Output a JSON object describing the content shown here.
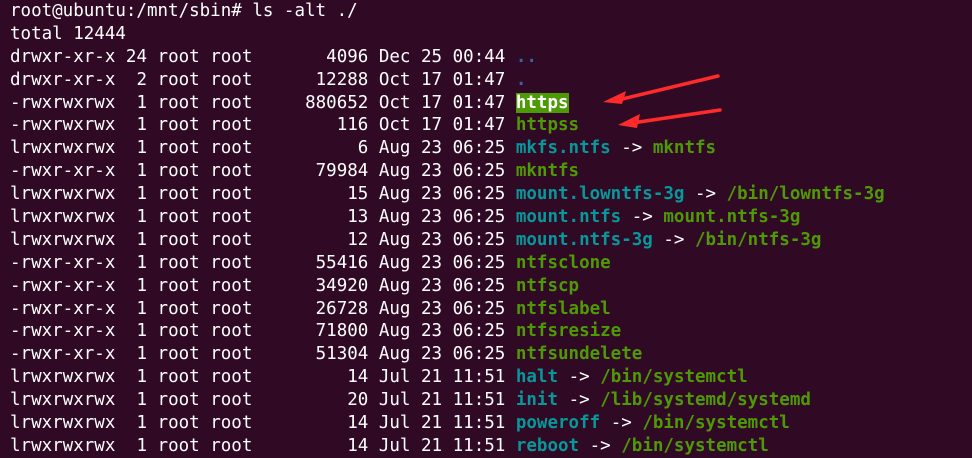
{
  "prompt": "root@ubuntu:/mnt/sbin# ls -alt ./",
  "total": "total 12444",
  "rows": [
    {
      "perms": "drwxr-xr-x",
      "links": "24",
      "owner": "root",
      "group": "root",
      "size": "4096",
      "month": "Dec",
      "day": "25",
      "time": "00:44",
      "name": "..",
      "type": "dir",
      "target": "",
      "target_type": ""
    },
    {
      "perms": "drwxr-xr-x",
      "links": "2",
      "owner": "root",
      "group": "root",
      "size": "12288",
      "month": "Oct",
      "day": "17",
      "time": "01:47",
      "name": ".",
      "type": "dir",
      "target": "",
      "target_type": ""
    },
    {
      "perms": "-rwxrwxrwx",
      "links": "1",
      "owner": "root",
      "group": "root",
      "size": "880652",
      "month": "Oct",
      "day": "17",
      "time": "01:47",
      "name": "https",
      "type": "exec-highlight",
      "target": "",
      "target_type": ""
    },
    {
      "perms": "-rwxrwxrwx",
      "links": "1",
      "owner": "root",
      "group": "root",
      "size": "116",
      "month": "Oct",
      "day": "17",
      "time": "01:47",
      "name": "httpss",
      "type": "exec",
      "target": "",
      "target_type": ""
    },
    {
      "perms": "lrwxrwxrwx",
      "links": "1",
      "owner": "root",
      "group": "root",
      "size": "6",
      "month": "Aug",
      "day": "23",
      "time": "06:25",
      "name": "mkfs.ntfs",
      "type": "link",
      "target": "mkntfs",
      "target_type": "exec"
    },
    {
      "perms": "-rwxr-xr-x",
      "links": "1",
      "owner": "root",
      "group": "root",
      "size": "79984",
      "month": "Aug",
      "day": "23",
      "time": "06:25",
      "name": "mkntfs",
      "type": "exec",
      "target": "",
      "target_type": ""
    },
    {
      "perms": "lrwxrwxrwx",
      "links": "1",
      "owner": "root",
      "group": "root",
      "size": "15",
      "month": "Aug",
      "day": "23",
      "time": "06:25",
      "name": "mount.lowntfs-3g",
      "type": "link",
      "target": "/bin/lowntfs-3g",
      "target_type": "exec"
    },
    {
      "perms": "lrwxrwxrwx",
      "links": "1",
      "owner": "root",
      "group": "root",
      "size": "13",
      "month": "Aug",
      "day": "23",
      "time": "06:25",
      "name": "mount.ntfs",
      "type": "link",
      "target": "mount.ntfs-3g",
      "target_type": "exec"
    },
    {
      "perms": "lrwxrwxrwx",
      "links": "1",
      "owner": "root",
      "group": "root",
      "size": "12",
      "month": "Aug",
      "day": "23",
      "time": "06:25",
      "name": "mount.ntfs-3g",
      "type": "link",
      "target": "/bin/ntfs-3g",
      "target_type": "exec"
    },
    {
      "perms": "-rwxr-xr-x",
      "links": "1",
      "owner": "root",
      "group": "root",
      "size": "55416",
      "month": "Aug",
      "day": "23",
      "time": "06:25",
      "name": "ntfsclone",
      "type": "exec",
      "target": "",
      "target_type": ""
    },
    {
      "perms": "-rwxr-xr-x",
      "links": "1",
      "owner": "root",
      "group": "root",
      "size": "34920",
      "month": "Aug",
      "day": "23",
      "time": "06:25",
      "name": "ntfscp",
      "type": "exec",
      "target": "",
      "target_type": ""
    },
    {
      "perms": "-rwxr-xr-x",
      "links": "1",
      "owner": "root",
      "group": "root",
      "size": "26728",
      "month": "Aug",
      "day": "23",
      "time": "06:25",
      "name": "ntfslabel",
      "type": "exec",
      "target": "",
      "target_type": ""
    },
    {
      "perms": "-rwxr-xr-x",
      "links": "1",
      "owner": "root",
      "group": "root",
      "size": "71800",
      "month": "Aug",
      "day": "23",
      "time": "06:25",
      "name": "ntfsresize",
      "type": "exec",
      "target": "",
      "target_type": ""
    },
    {
      "perms": "-rwxr-xr-x",
      "links": "1",
      "owner": "root",
      "group": "root",
      "size": "51304",
      "month": "Aug",
      "day": "23",
      "time": "06:25",
      "name": "ntfsundelete",
      "type": "exec",
      "target": "",
      "target_type": ""
    },
    {
      "perms": "lrwxrwxrwx",
      "links": "1",
      "owner": "root",
      "group": "root",
      "size": "14",
      "month": "Jul",
      "day": "21",
      "time": "11:51",
      "name": "halt",
      "type": "link",
      "target": "/bin/systemctl",
      "target_type": "exec"
    },
    {
      "perms": "lrwxrwxrwx",
      "links": "1",
      "owner": "root",
      "group": "root",
      "size": "20",
      "month": "Jul",
      "day": "21",
      "time": "11:51",
      "name": "init",
      "type": "link",
      "target": "/lib/systemd/systemd",
      "target_type": "exec"
    },
    {
      "perms": "lrwxrwxrwx",
      "links": "1",
      "owner": "root",
      "group": "root",
      "size": "14",
      "month": "Jul",
      "day": "21",
      "time": "11:51",
      "name": "poweroff",
      "type": "link",
      "target": "/bin/systemctl",
      "target_type": "exec"
    },
    {
      "perms": "lrwxrwxrwx",
      "links": "1",
      "owner": "root",
      "group": "root",
      "size": "14",
      "month": "Jul",
      "day": "21",
      "time": "11:51",
      "name": "reboot",
      "type": "link",
      "target": "/bin/systemctl",
      "target_type": "exec"
    }
  ],
  "link_arrow": "->",
  "colors": {
    "background": "#300a24",
    "text": "#ffffff",
    "directory": "#3465a4",
    "executable": "#4e9a06",
    "symlink": "#06989a",
    "highlight_bg": "#4e9a06",
    "annotation_arrow": "#ff2a2a"
  },
  "annotations": [
    {
      "type": "arrow",
      "points_to": "https",
      "color": "#ff2a2a"
    },
    {
      "type": "arrow",
      "points_to": "httpss",
      "color": "#ff2a2a"
    }
  ]
}
